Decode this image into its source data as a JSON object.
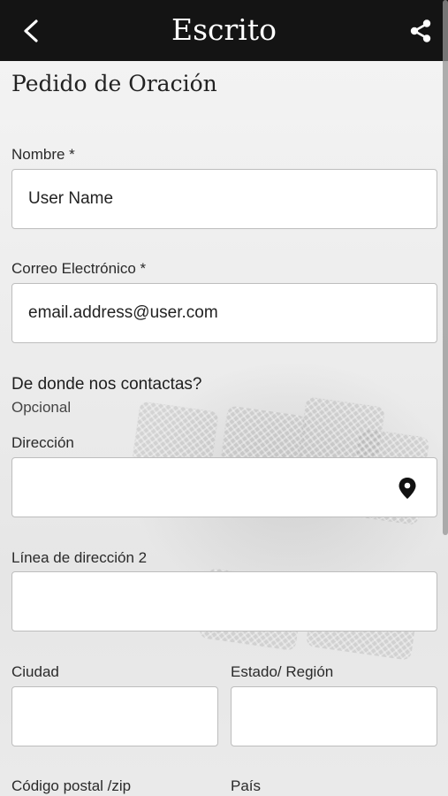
{
  "header": {
    "title": "Escrito"
  },
  "form": {
    "title": "Pedido de Oración",
    "name": {
      "label": "Nombre *",
      "value": "User Name"
    },
    "email": {
      "label": "Correo Electrónico *",
      "value": "email.address@user.com"
    },
    "contact_section": {
      "heading": "De donde nos contactas?",
      "note": "Opcional"
    },
    "address": {
      "label": "Dirección",
      "value": ""
    },
    "address2": {
      "label": "Línea de dirección 2",
      "value": ""
    },
    "city": {
      "label": "Ciudad",
      "value": ""
    },
    "state": {
      "label": "Estado/ Región",
      "value": ""
    },
    "zip": {
      "label": "Código postal /zip"
    },
    "country": {
      "label": "País"
    }
  },
  "icons": {
    "back": "chevron-left-icon",
    "share": "share-icon",
    "location": "map-pin-icon"
  },
  "colors": {
    "topbar": "#141414",
    "field_border": "#bdbdbd"
  }
}
